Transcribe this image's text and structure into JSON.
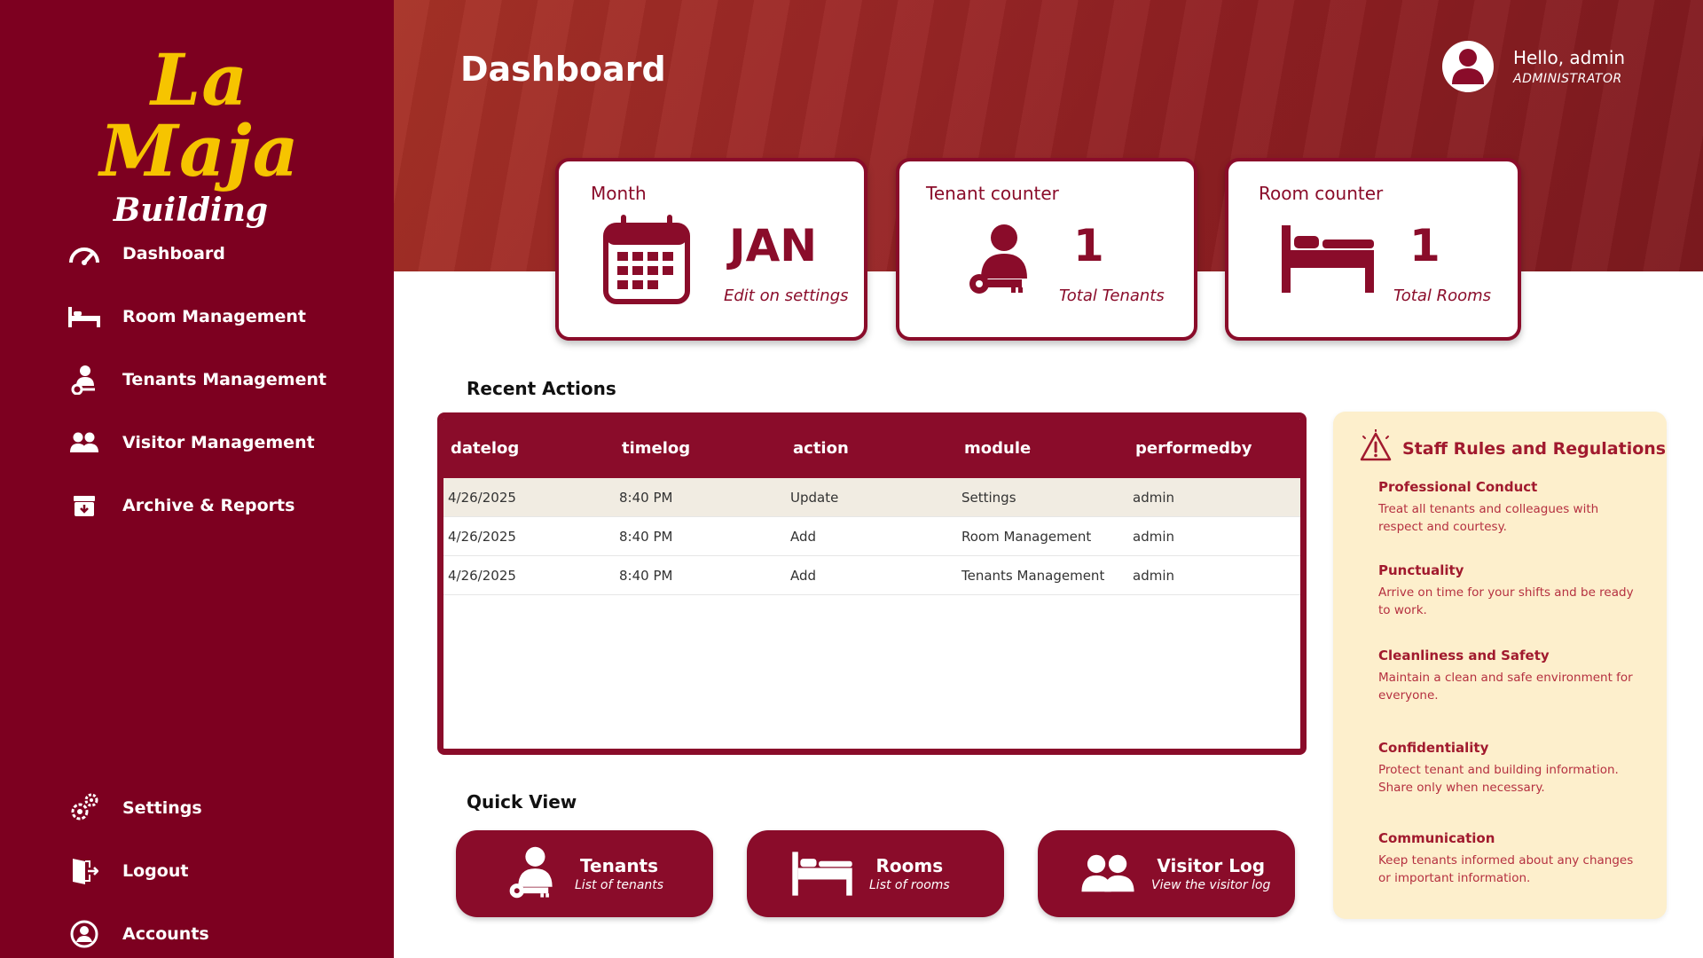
{
  "brand": {
    "name": "La Maja",
    "subtitle": "Building"
  },
  "sidebar": {
    "items": [
      {
        "label": "Dashboard",
        "icon": "gauge-icon"
      },
      {
        "label": "Room Management",
        "icon": "bed-icon"
      },
      {
        "label": "Tenants Management",
        "icon": "tenant-key-icon"
      },
      {
        "label": "Visitor Management",
        "icon": "users-icon"
      },
      {
        "label": "Archive & Reports",
        "icon": "archive-icon"
      }
    ],
    "bottom_items": [
      {
        "label": "Settings",
        "icon": "gears-icon"
      },
      {
        "label": "Logout",
        "icon": "door-exit-icon"
      },
      {
        "label": "Accounts",
        "icon": "user-circle-icon"
      }
    ]
  },
  "header": {
    "title": "Dashboard",
    "greeting": "Hello, admin",
    "role": "ADMINISTRATOR"
  },
  "cards": {
    "month": {
      "title": "Month",
      "value": "JAN",
      "sub": "Edit on settings",
      "icon": "calendar-icon"
    },
    "tenants": {
      "title": "Tenant counter",
      "value": "1",
      "sub": "Total Tenants",
      "icon": "tenant-key-icon"
    },
    "rooms": {
      "title": "Room counter",
      "value": "1",
      "sub": "Total Rooms",
      "icon": "bed-icon"
    }
  },
  "recent": {
    "title": "Recent Actions",
    "columns": [
      "datelog",
      "timelog",
      "action",
      "module",
      "performedby"
    ],
    "rows": [
      [
        "4/26/2025",
        "8:40 PM",
        "Update",
        "Settings",
        "admin"
      ],
      [
        "4/26/2025",
        "8:40 PM",
        "Add",
        "Room Management",
        "admin"
      ],
      [
        "4/26/2025",
        "8:40 PM",
        "Add",
        "Tenants Management",
        "admin"
      ]
    ]
  },
  "quick_view": {
    "title": "Quick View",
    "items": [
      {
        "title": "Tenants",
        "sub": "List of tenants",
        "icon": "tenant-key-icon"
      },
      {
        "title": "Rooms",
        "sub": "List of rooms",
        "icon": "bed-icon"
      },
      {
        "title": "Visitor Log",
        "sub": "View the visitor log",
        "icon": "users-icon"
      }
    ]
  },
  "rules": {
    "title": "Staff Rules and Regulations",
    "icon": "warning-icon",
    "items": [
      {
        "title": "Professional Conduct",
        "text": "Treat all tenants and colleagues with respect and courtesy."
      },
      {
        "title": "Punctuality",
        "text": "Arrive on time for your shifts and be ready to work."
      },
      {
        "title": "Cleanliness and Safety",
        "text": "Maintain a clean and safe environment for everyone."
      },
      {
        "title": "Confidentiality",
        "text": "Protect tenant and building information. Share only when necessary."
      },
      {
        "title": "Communication",
        "text": "Keep tenants informed about any changes or important information."
      }
    ]
  },
  "colors": {
    "primary": "#8a0c2a",
    "sidebar": "#7d0020",
    "accent": "#f6c400",
    "panel": "#fdefcc"
  }
}
